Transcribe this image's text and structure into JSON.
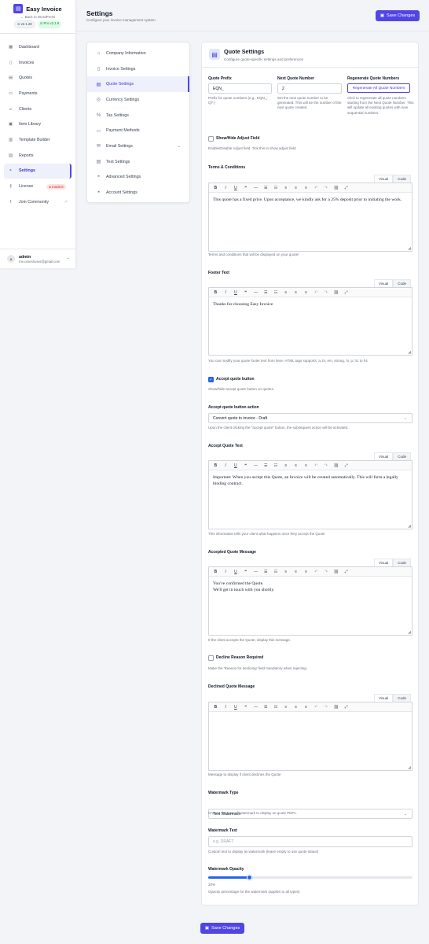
{
  "sidebar": {
    "brand": "Easy Invoice",
    "back": "Back to WordPress",
    "version": "v2.1.20",
    "pro_version": "Pro v2.1.8",
    "items": [
      {
        "label": "Dashboard",
        "icon": "grid-icon"
      },
      {
        "label": "Invoices",
        "icon": "file-icon"
      },
      {
        "label": "Quotes",
        "icon": "document-icon"
      },
      {
        "label": "Payments",
        "icon": "card-icon"
      },
      {
        "label": "Clients",
        "icon": "users-icon"
      },
      {
        "label": "Item Library",
        "icon": "box-icon"
      },
      {
        "label": "Template Builder",
        "icon": "template-icon"
      },
      {
        "label": "Reports",
        "icon": "chart-icon"
      },
      {
        "label": "Settings",
        "icon": "gauge-icon"
      },
      {
        "label": "License",
        "icon": "key-icon",
        "badge": "Inactive"
      },
      {
        "label": "Join Community",
        "icon": "facebook-icon"
      }
    ],
    "active_index": 8,
    "user": {
      "initial": "a",
      "name": "admin",
      "email": "me.umeshuser@gmail.com"
    }
  },
  "header": {
    "title": "Settings",
    "subtitle": "Configure your invoice management system",
    "save_label": "Save Changes"
  },
  "submenu": {
    "items": [
      "Company Information",
      "Invoice Settings",
      "Quote Settings",
      "Currency Settings",
      "Tax Settings",
      "Payment Methods",
      "Email Settings",
      "Text Settings",
      "Advanced Settings",
      "Account Settings"
    ],
    "active_index": 2
  },
  "quote": {
    "title": "Quote Settings",
    "subtitle": "Configure quote-specific settings and preferences",
    "prefix": {
      "label": "Quote Prefix",
      "value": "EQN_",
      "help": "Prefix for quote numbers (e.g., EQN_, QT-)"
    },
    "next_number": {
      "label": "Next Quote Number",
      "value": "2",
      "help": "Set the next quote number to be generated. This will be the number of the next quote created."
    },
    "regenerate": {
      "label": "Regenerate Quote Numbers",
      "button": "Regenerate All Quote Numbers",
      "help": "Click to regenerate all quote numbers starting from the Next Quote Number. This will update all existing quotes with new sequential numbers."
    },
    "adjust": {
      "label": "Show/Hide Adjust Field",
      "help": "Enable/Disable Adjust field. Tick this to show adjust field",
      "checked": false
    },
    "terms": {
      "label": "Terms & Conditions",
      "content": "This quote has a fixed price. Upon acceptance, we kindly ask for a 25% deposit prior to initiating the work.",
      "help": "Terms and conditions that will be displayed on your quote!"
    },
    "footer": {
      "label": "Footer Text",
      "content": "Thanks for choosing Easy Invoice",
      "help": "You can modify your quote footer text from here. HTML tags supports: a, br, em, strong, hr, p, h1 to h4"
    },
    "accept_button": {
      "label": "Accept quote button",
      "help": "Show/hide accept quote button on quotes.",
      "checked": true
    },
    "accept_action": {
      "label": "Accept quote button action",
      "value": "Convert quote to invoice - Draft",
      "help": "Upon the client clicking the \"accept quote\" button, the subsequent action will be activated."
    },
    "accept_text": {
      "label": "Accept Quote Text",
      "content": "Important: When you accept this Quote, an Invoice will be created automatically. This will form a legally binding contract.",
      "help": "This information tells your client what happens once they accept the Quote"
    },
    "accepted_message": {
      "label": "Accepted Quote Message",
      "line1": "You've confirmed the Quote.",
      "line2": "We'll get in touch with you shortly.",
      "help": "If the client accepts the Quote, display this message."
    },
    "decline_required": {
      "label": "Decline Reason Required",
      "help": "Make the 'Reason for declining' field mandatory when rejecting.",
      "checked": false
    },
    "declined_message": {
      "label": "Declined Quote Message",
      "content": "",
      "help": "Message to display if client declines the Quote"
    },
    "watermark_type": {
      "label": "Watermark Type",
      "value": "Text Watermark",
      "help": "Choose the type of watermark to display on quote PDFs."
    },
    "watermark_text": {
      "label": "Watermark Text",
      "placeholder": "e.g. DRAFT",
      "help": "Custom text to display as watermark (leave empty to use quote status)"
    },
    "watermark_opacity": {
      "label": "Watermark Opacity",
      "value": 0.2,
      "display": "20%",
      "help": "Opacity percentage for the watermark (applies to all types)"
    }
  },
  "editor": {
    "tab_visual": "Visual",
    "tab_code": "Code",
    "toolbar": [
      "bold-icon",
      "italic-icon",
      "underline-icon",
      "quote-icon",
      "hr-icon",
      "bullet-list-icon",
      "numbered-list-icon",
      "align-left-icon",
      "align-center-icon",
      "align-right-icon",
      "undo-icon",
      "redo-icon",
      "link-icon",
      "fullscreen-icon"
    ],
    "toolbar_glyphs": [
      "B",
      "I",
      "U",
      "❝",
      "―",
      "☰",
      "☷",
      "≡",
      "≡",
      "≡",
      "↶",
      "↷",
      "⛓",
      "⤢"
    ]
  },
  "colors": {
    "accent": "#5046e5",
    "link": "#2563eb",
    "danger": "#dc2626",
    "success": "#15803d"
  }
}
